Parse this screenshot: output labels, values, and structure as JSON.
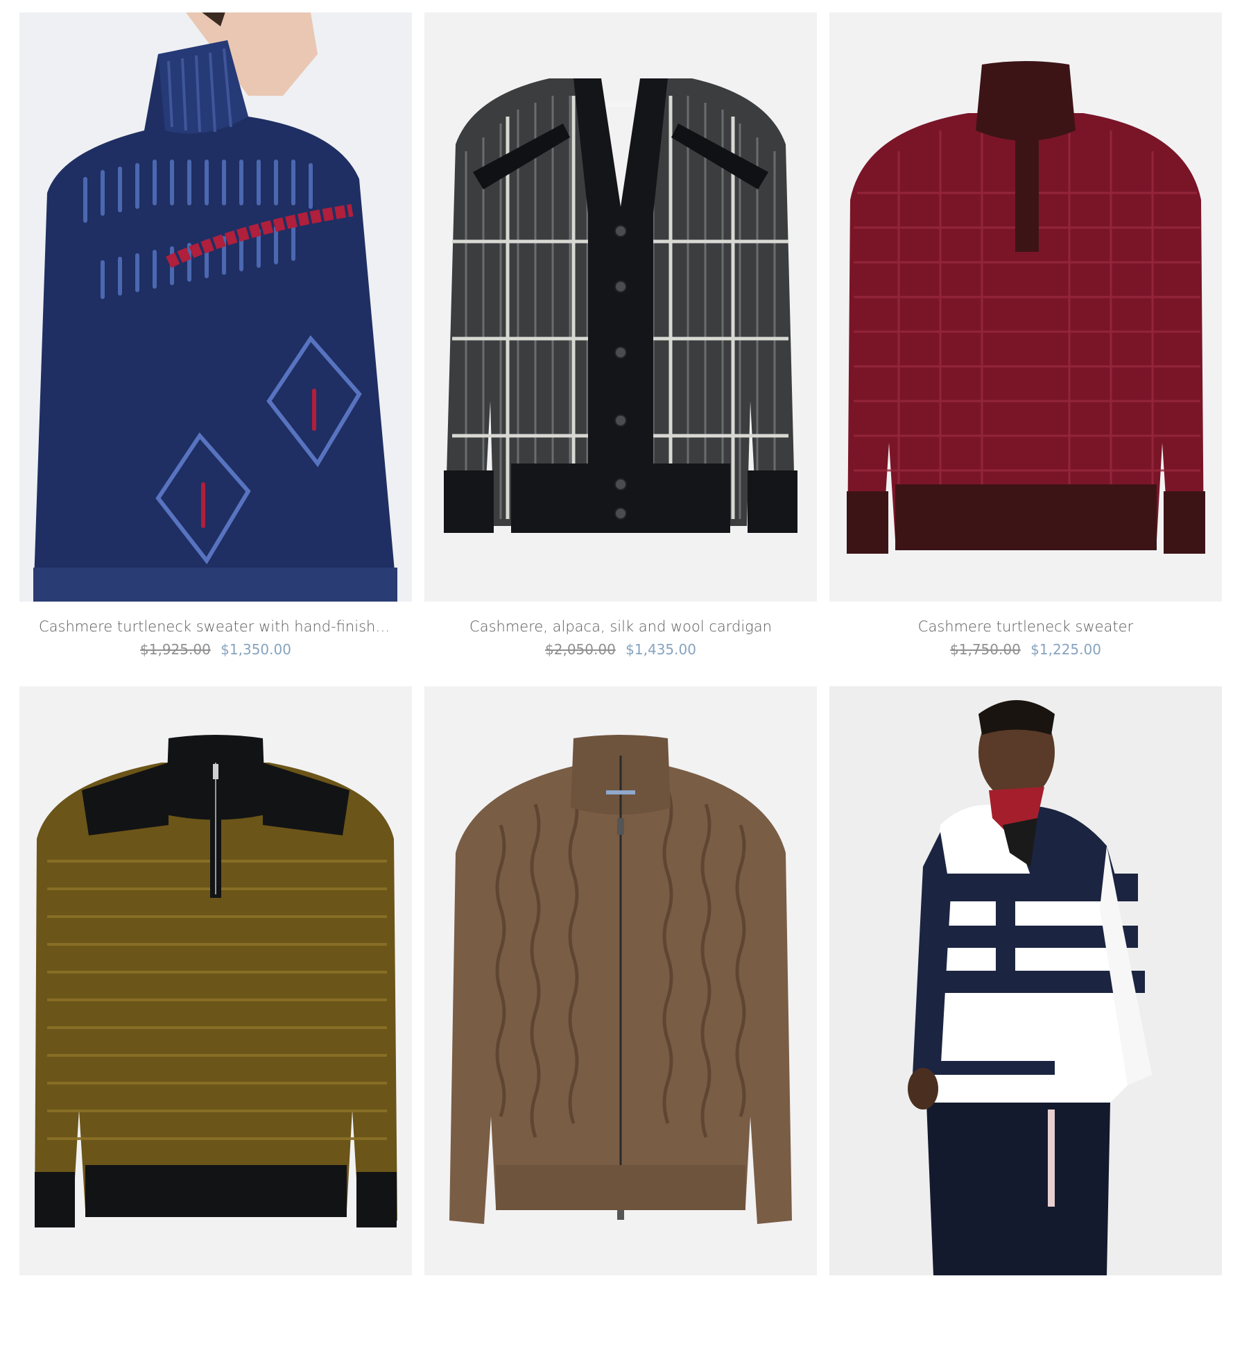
{
  "colors": {
    "card_background": "#f2f2f3",
    "title_text": "#5a5a5a",
    "old_price_text": "#8f8f8f",
    "sale_price_text": "#86a3bf"
  },
  "products": [
    {
      "title": "Cashmere turtleneck sweater with hand-finished…",
      "old_price": "$1,925.00",
      "sale_price": "$1,350.00",
      "image_icon": "navy-turtleneck-sweater-image"
    },
    {
      "title": "Cashmere, alpaca, silk and wool cardigan",
      "old_price": "$2,050.00",
      "sale_price": "$1,435.00",
      "image_icon": "gray-check-cardigan-image"
    },
    {
      "title": "Cashmere turtleneck sweater",
      "old_price": "$1,750.00",
      "sale_price": "$1,225.00",
      "image_icon": "burgundy-half-placket-sweater-image"
    },
    {
      "image_icon": "olive-half-zip-sweater-image"
    },
    {
      "image_icon": "brown-cable-zip-cardigan-image"
    },
    {
      "image_icon": "navy-white-striped-hoodie-model-image"
    }
  ]
}
